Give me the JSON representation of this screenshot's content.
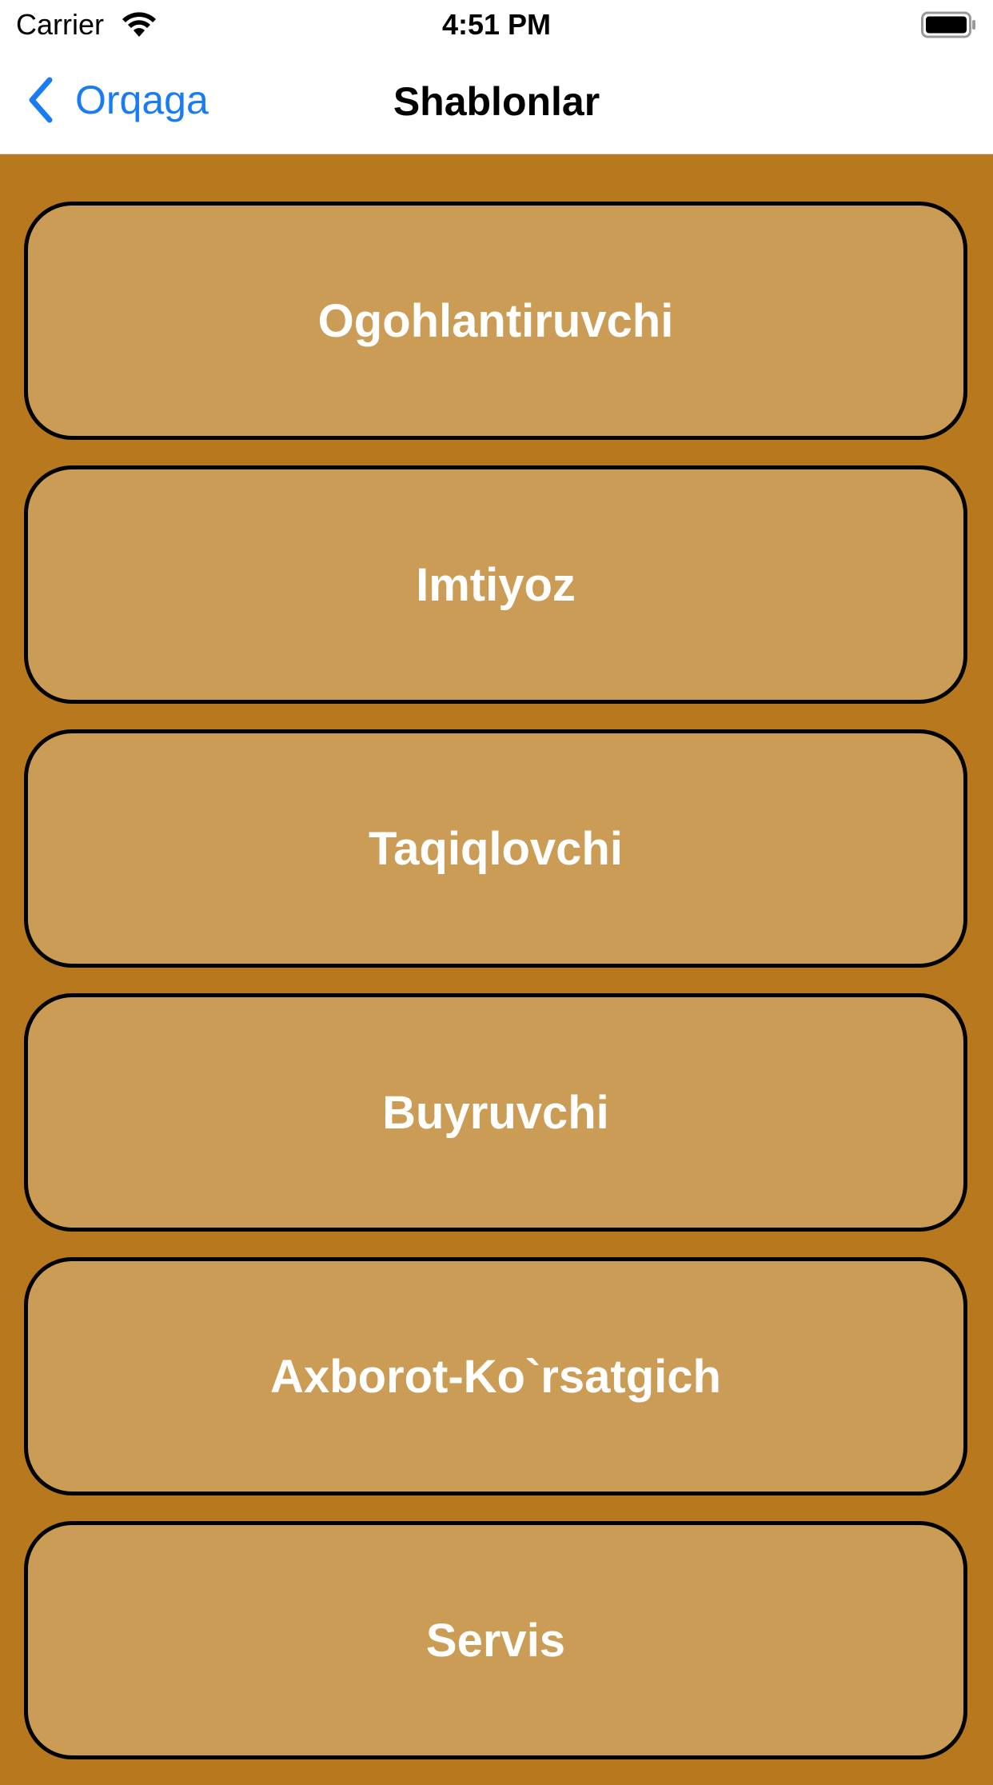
{
  "status_bar": {
    "carrier": "Carrier",
    "time": "4:51 PM",
    "wifi_icon": "wifi-icon",
    "battery_icon": "battery-icon"
  },
  "nav": {
    "back_label": "Orqaga",
    "back_icon": "chevron-left-icon",
    "title": "Shablonlar"
  },
  "colors": {
    "background": "#b8791e",
    "button_fill": "#cb9c55",
    "button_border": "#000000",
    "button_text": "#ffffff",
    "link": "#1a7cf5"
  },
  "items": [
    {
      "label": "Ogohlantiruvchi"
    },
    {
      "label": "Imtiyoz"
    },
    {
      "label": "Taqiqlovchi"
    },
    {
      "label": "Buyruvchi"
    },
    {
      "label": "Axborot-Ko`rsatgich"
    },
    {
      "label": "Servis"
    }
  ]
}
